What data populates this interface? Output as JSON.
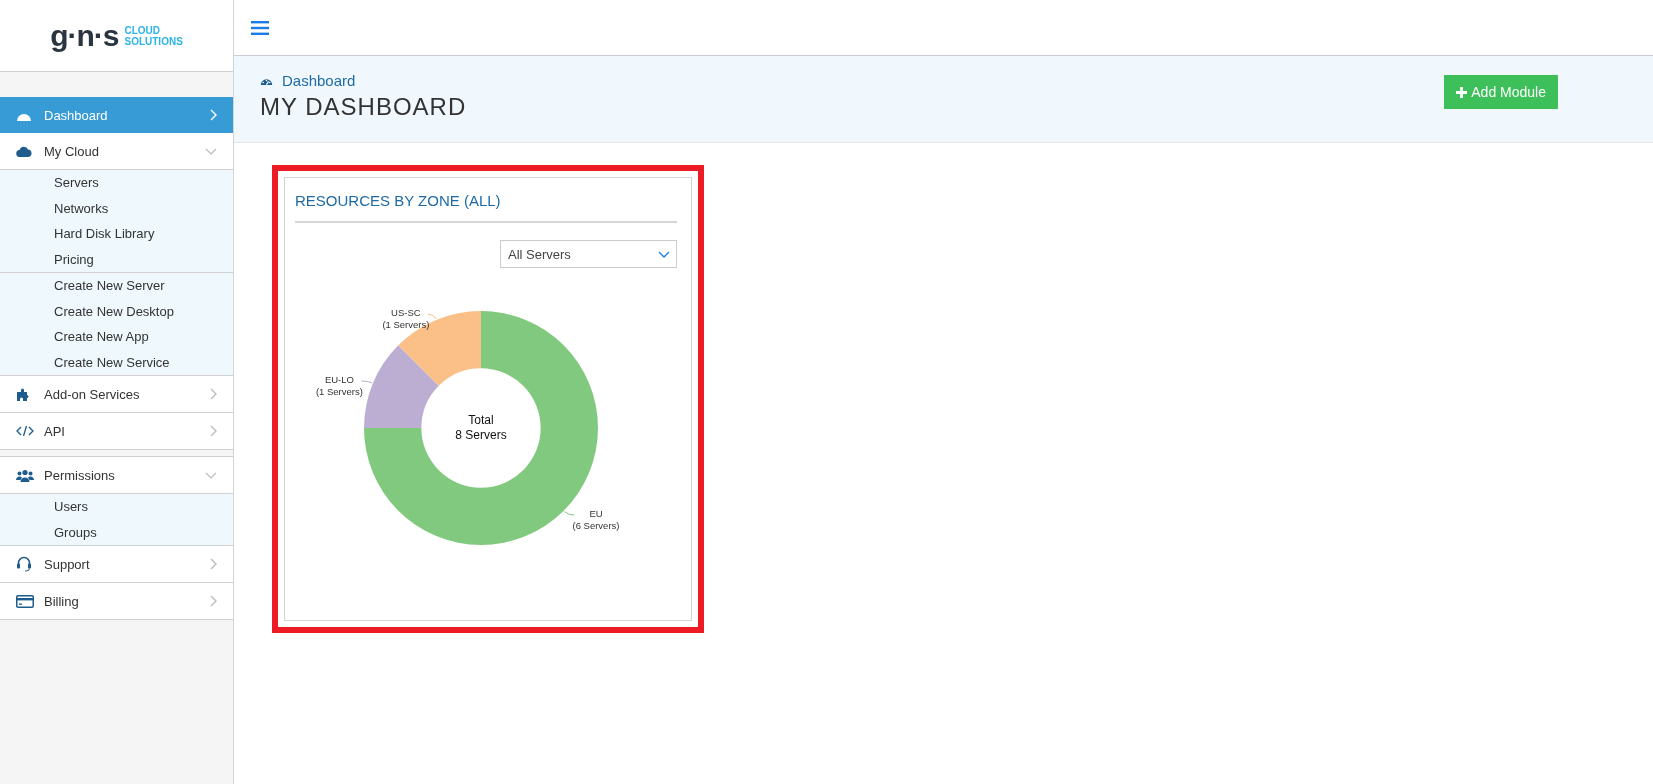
{
  "logo": {
    "mark": "g·n·s",
    "line_1": "CLOUD",
    "line_2": "SOLUTIONS"
  },
  "sidebar": {
    "sections": [
      [
        {
          "label": "Dashboard",
          "selected": true,
          "expanded": false
        },
        {
          "label": "My Cloud",
          "selected": false,
          "expanded": true,
          "groups": [
            [
              {
                "label": "Servers"
              },
              {
                "label": "Networks"
              },
              {
                "label": "Hard Disk Library"
              },
              {
                "label": "Pricing"
              }
            ],
            [
              {
                "label": "Create New Server"
              },
              {
                "label": "Create New Desktop"
              },
              {
                "label": "Create New App"
              },
              {
                "label": "Create New Service"
              }
            ]
          ]
        },
        {
          "label": "Add-on Services",
          "selected": false,
          "expanded": false
        },
        {
          "label": "API",
          "selected": false,
          "expanded": false
        }
      ],
      [
        {
          "label": "Permissions",
          "selected": false,
          "expanded": true,
          "groups": [
            [
              {
                "label": "Users"
              },
              {
                "label": "Groups"
              }
            ]
          ]
        },
        {
          "label": "Support",
          "selected": false,
          "expanded": false
        },
        {
          "label": "Billing",
          "selected": false,
          "expanded": false
        }
      ]
    ]
  },
  "header": {
    "breadcrumb": "Dashboard",
    "title": "MY DASHBOARD",
    "add_button": "Add Module"
  },
  "widget": {
    "title": "RESOURCES BY ZONE (ALL)",
    "highlighted": true,
    "filter": {
      "value": "All Servers"
    },
    "center_line_1": "Total",
    "center_line_2": "8 Servers",
    "chart_data": {
      "type": "donut",
      "categories": [
        "EU",
        "EU-LO",
        "US-SC"
      ],
      "values": [
        6,
        1,
        1
      ],
      "colors": [
        "#80c97e",
        "#bcaed3",
        "#fbc087"
      ],
      "value_labels": [
        "(6 Servers)",
        "(1 Servers)",
        "(1 Servers)"
      ]
    }
  }
}
